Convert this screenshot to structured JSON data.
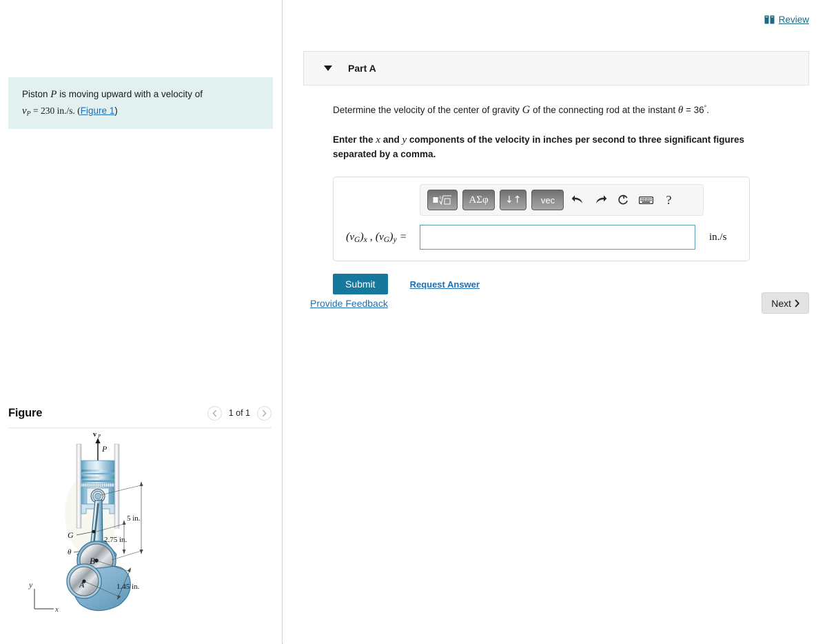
{
  "left": {
    "problem": {
      "line1_pre": "Piston ",
      "line1_var": "P",
      "line1_post": " is moving upward with a velocity of",
      "line2_var": "v",
      "line2_sub": "P",
      "line2_eq": " = 230 in./s. (",
      "line2_link": "Figure 1",
      "line2_close": ")"
    },
    "figure": {
      "title": "Figure",
      "prev_icon": "chevron-left-icon",
      "next_icon": "chevron-right-icon",
      "counter": "1 of 1",
      "labels": {
        "velocity": "v",
        "velocity_sub": "P",
        "piston": "P",
        "center_gravity": "G",
        "theta": "θ",
        "crank_pin": "B",
        "crank_center": "A",
        "dim_rod": "5 in.",
        "dim_g": "2.75 in.",
        "dim_crank": "1.45 in.",
        "axis_y": "y",
        "axis_x": "x"
      }
    }
  },
  "right": {
    "review": {
      "label": "Review",
      "icon": "book-icon"
    },
    "part": {
      "caret_icon": "caret-down-icon",
      "label": "Part A",
      "question_pre": "Determine the velocity of the center of gravity ",
      "question_var": "G",
      "question_mid": " of the connecting rod at the instant ",
      "question_theta": "θ",
      "question_angle": " = 36",
      "question_deg": "°",
      "question_end": ".",
      "instruction_pre": "Enter the ",
      "instruction_x": "x",
      "instruction_and": " and ",
      "instruction_y": "y",
      "instruction_post": " components of the velocity in inches per second to three significant figures separated by a comma."
    },
    "toolbar": {
      "buttons": [
        {
          "name": "template-sqrt-button",
          "label": "√"
        },
        {
          "name": "greek-letters-button",
          "label": "ΑΣφ"
        },
        {
          "name": "arrows-button",
          "label": "↓↑"
        },
        {
          "name": "vector-button",
          "label": "vec"
        }
      ],
      "undo_icon": "undo-arrow-icon",
      "redo_icon": "redo-arrow-icon",
      "reset_icon": "refresh-icon",
      "keyboard_icon": "keyboard-icon",
      "help_icon": "help-question-icon"
    },
    "answer": {
      "label_v": "v",
      "label": "(vG)x , (vG)y  =",
      "value": "",
      "placeholder": "",
      "unit": "in./s"
    },
    "actions": {
      "submit_label": "Submit",
      "request_answer_label": "Request Answer"
    },
    "footer": {
      "feedback_label": "Provide Feedback",
      "next_label": "Next",
      "next_icon": "chevron-right-icon"
    }
  },
  "colors": {
    "problem_box_bg": "#e2f1f0",
    "submit_bg": "#15789c",
    "link_blue": "#1f6fb2",
    "review_teal": "#186b83",
    "input_border": "#5b9cb5",
    "figure_blue": "#8fb9d4"
  }
}
